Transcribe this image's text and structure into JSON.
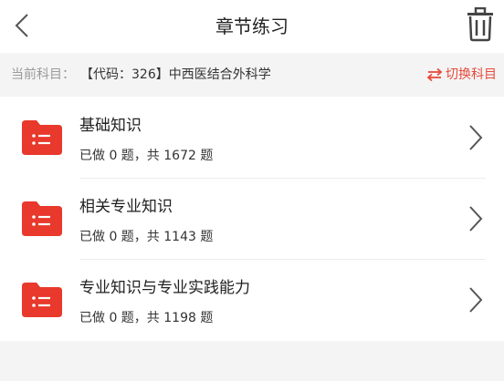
{
  "header": {
    "title": "章节练习"
  },
  "subject": {
    "label": "当前科目：",
    "name": "【代码：326】中西医结合外科学",
    "switch_label": "切换科目"
  },
  "chapters": [
    {
      "title": "基础知识",
      "progress": "已做 0 题，共 1672 题"
    },
    {
      "title": "相关专业知识",
      "progress": "已做 0 题，共 1143 题"
    },
    {
      "title": "专业知识与专业实践能力",
      "progress": "已做 0 题，共 1198 题"
    }
  ],
  "colors": {
    "accent": "#e84a3c",
    "folder": "#e8392c"
  }
}
